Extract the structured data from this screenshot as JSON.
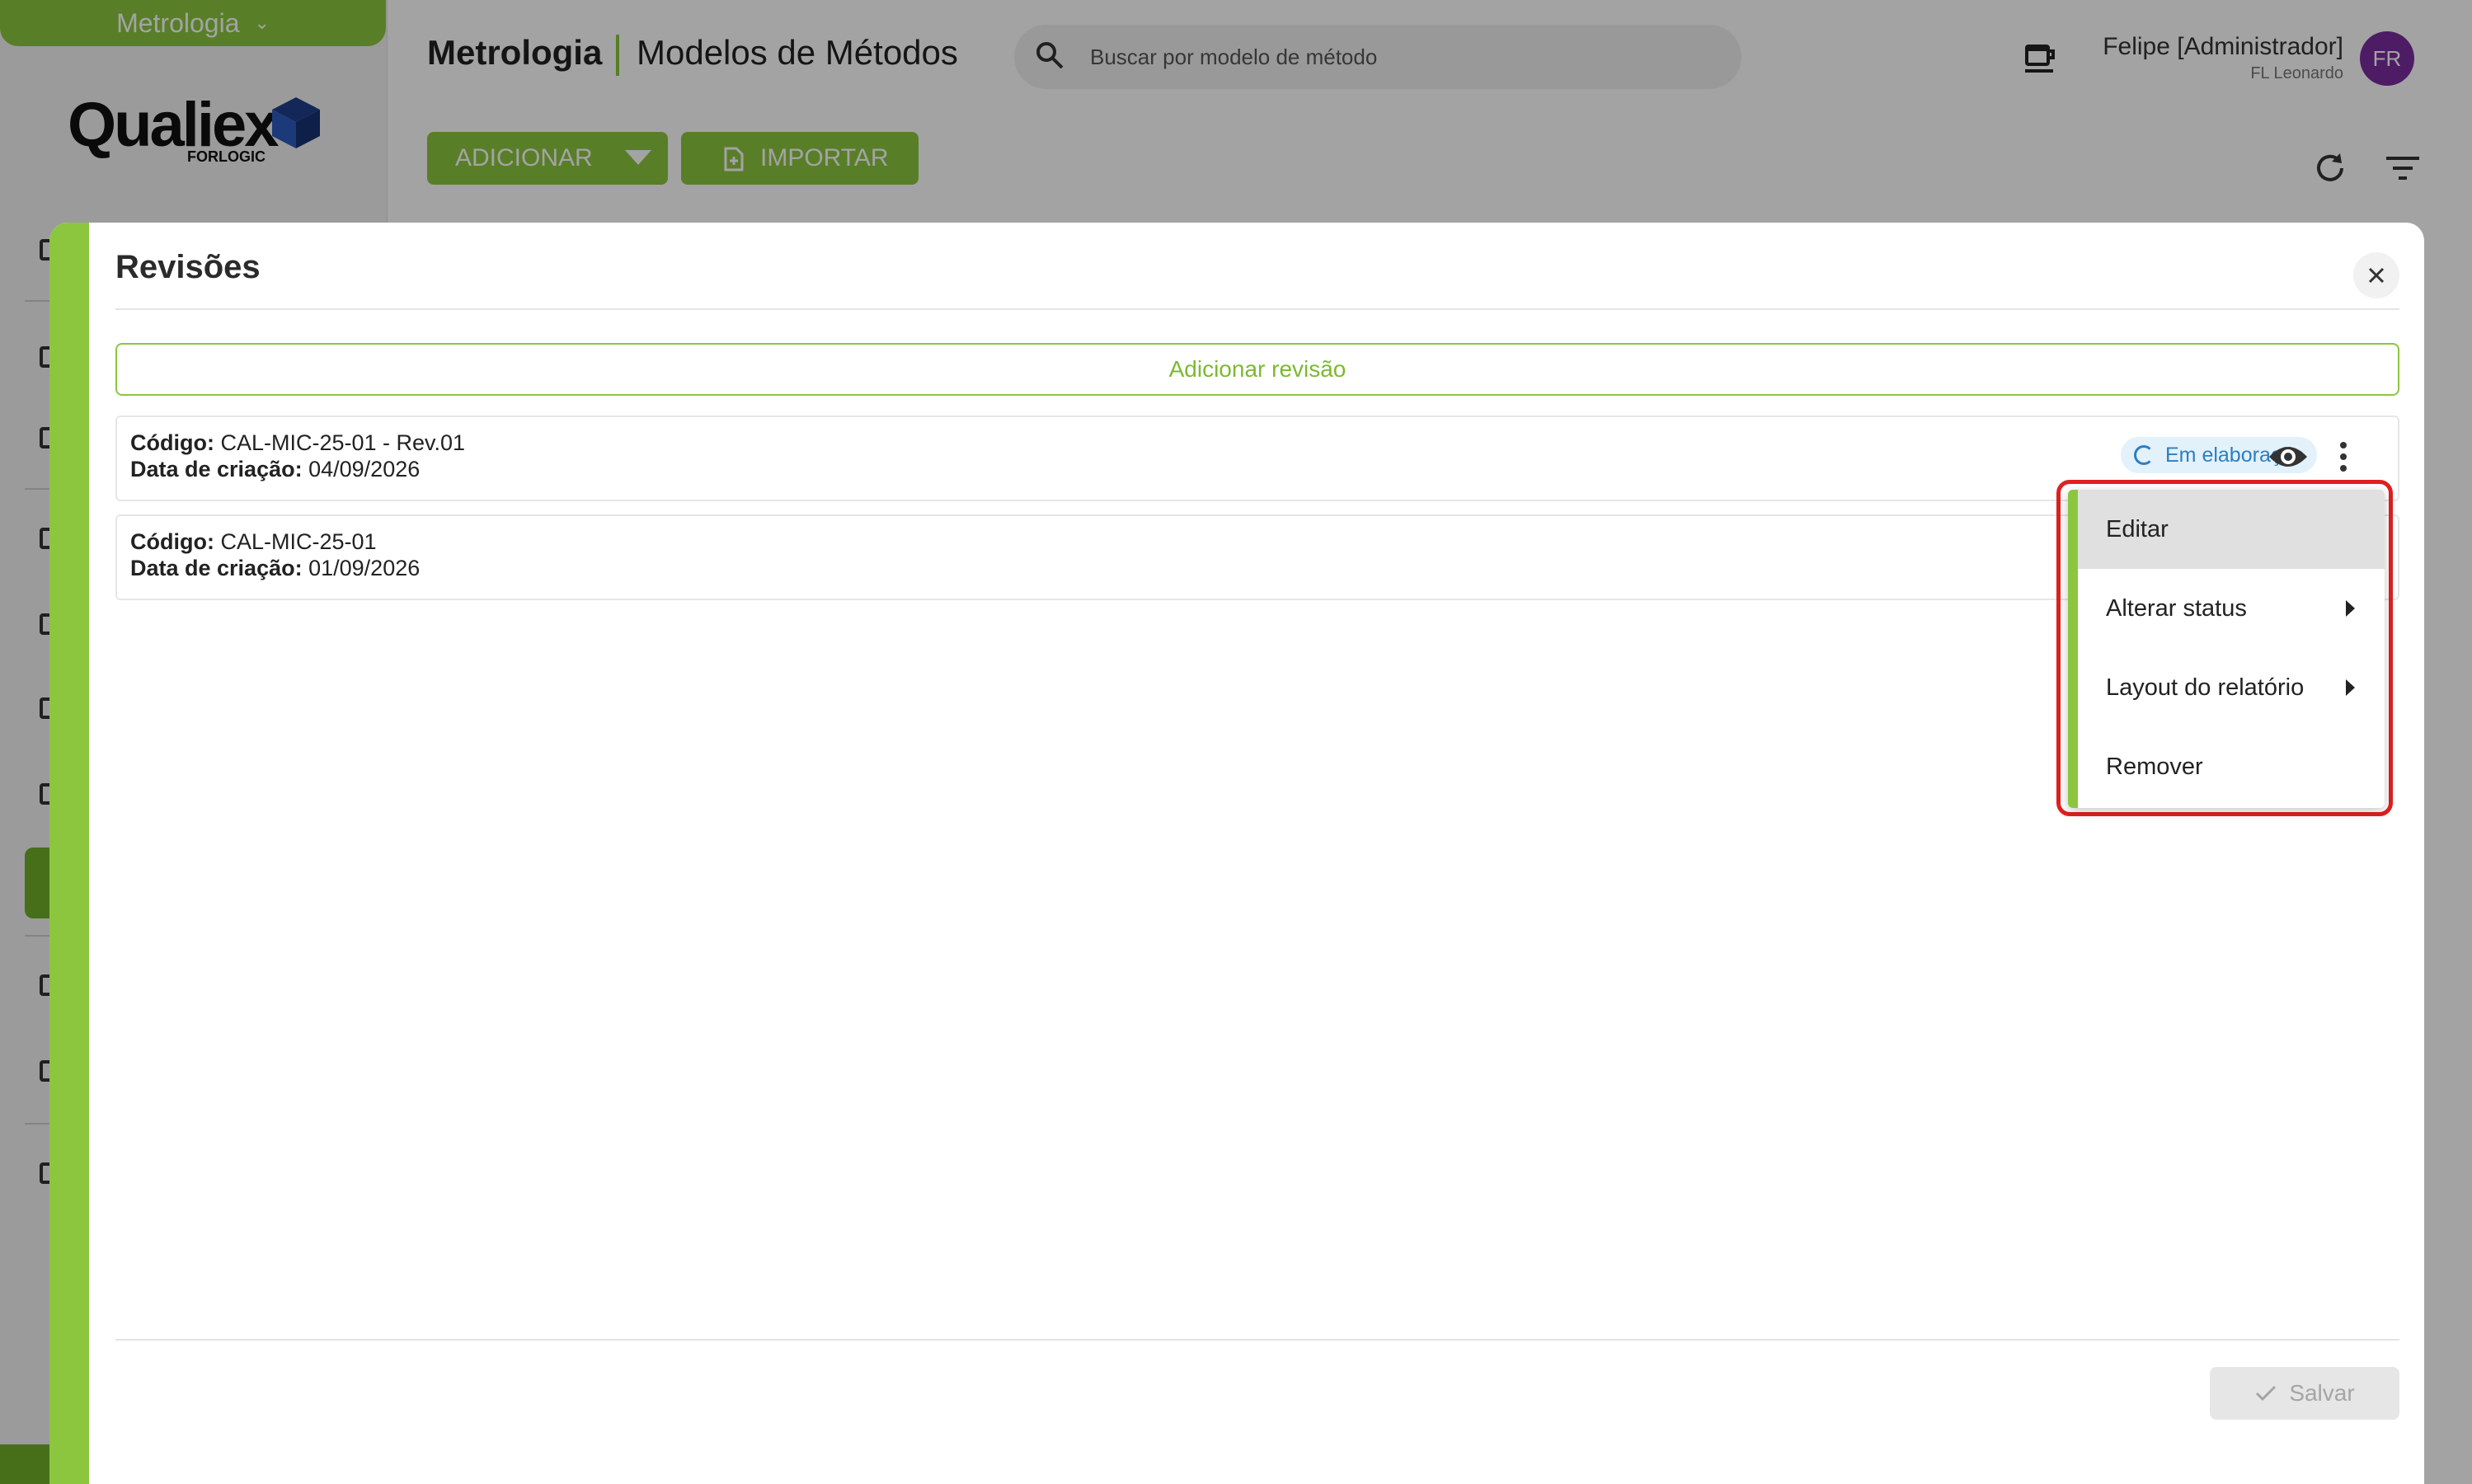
{
  "app": {
    "module": "Metrologia",
    "logo": {
      "word": "Qualiex",
      "sub": "FORLOGIC"
    },
    "header": {
      "title": "Metrologia",
      "subtitle": "Modelos de Métodos"
    },
    "search": {
      "placeholder": "Buscar por modelo de método"
    },
    "user": {
      "name": "Felipe [Administrador]",
      "company": "FL Leonardo",
      "initials": "FR"
    },
    "toolbar": {
      "add_label": "ADICIONAR",
      "import_label": "IMPORTAR"
    }
  },
  "modal": {
    "title": "Revisões",
    "add_revision_label": "Adicionar revisão",
    "revisions": [
      {
        "code_label": "Código:",
        "code": "CAL-MIC-25-01 - Rev.01",
        "date_label": "Data de criação:",
        "date": "04/09/2026",
        "status": "Em elaboração"
      },
      {
        "code_label": "Código:",
        "code": "CAL-MIC-25-01",
        "date_label": "Data de criação:",
        "date": "01/09/2026"
      }
    ],
    "save_label": "Salvar"
  },
  "context_menu": {
    "items": [
      {
        "label": "Editar"
      },
      {
        "label": "Alterar status"
      },
      {
        "label": "Layout do relatório"
      },
      {
        "label": "Remover"
      }
    ]
  },
  "colors": {
    "brand_green": "#8cc63f",
    "highlight_red": "#e02020",
    "status_blue": "#2a7fc4",
    "avatar_purple": "#7b2d9e"
  }
}
